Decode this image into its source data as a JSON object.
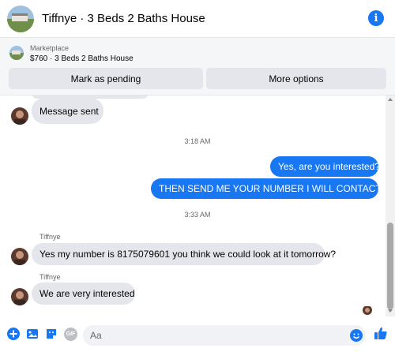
{
  "header": {
    "title": "Tiffnye · 3 Beds 2 Baths House"
  },
  "listing": {
    "category": "Marketplace",
    "price_title": "$760 · 3 Beds 2 Baths House",
    "mark_pending_label": "Mark as pending",
    "more_options_label": "More options"
  },
  "conversation": {
    "msg_sent": "Message sent",
    "time1": "3:18 AM",
    "out1": "Yes, are you interested?",
    "out2": "THEN SEND ME YOUR NUMBER I WILL CONTACT YOU",
    "time2": "3:33 AM",
    "sender1": "Tiffnye",
    "in1": "Yes my number is 8175079601 you think we could look at it tomorrow?",
    "sender2": "Tiffnye",
    "in2": "We are very interested"
  },
  "composer": {
    "placeholder": "Aa",
    "icons": [
      "plus-icon",
      "photo-icon",
      "sticker-icon",
      "gif-icon",
      "emoji-icon",
      "thumbs-up-icon"
    ],
    "gif_label": "GIF"
  },
  "colors": {
    "accent": "#1877f2",
    "incoming_bubble": "#e4e6eb",
    "listing_bg": "#f5f6f7"
  }
}
